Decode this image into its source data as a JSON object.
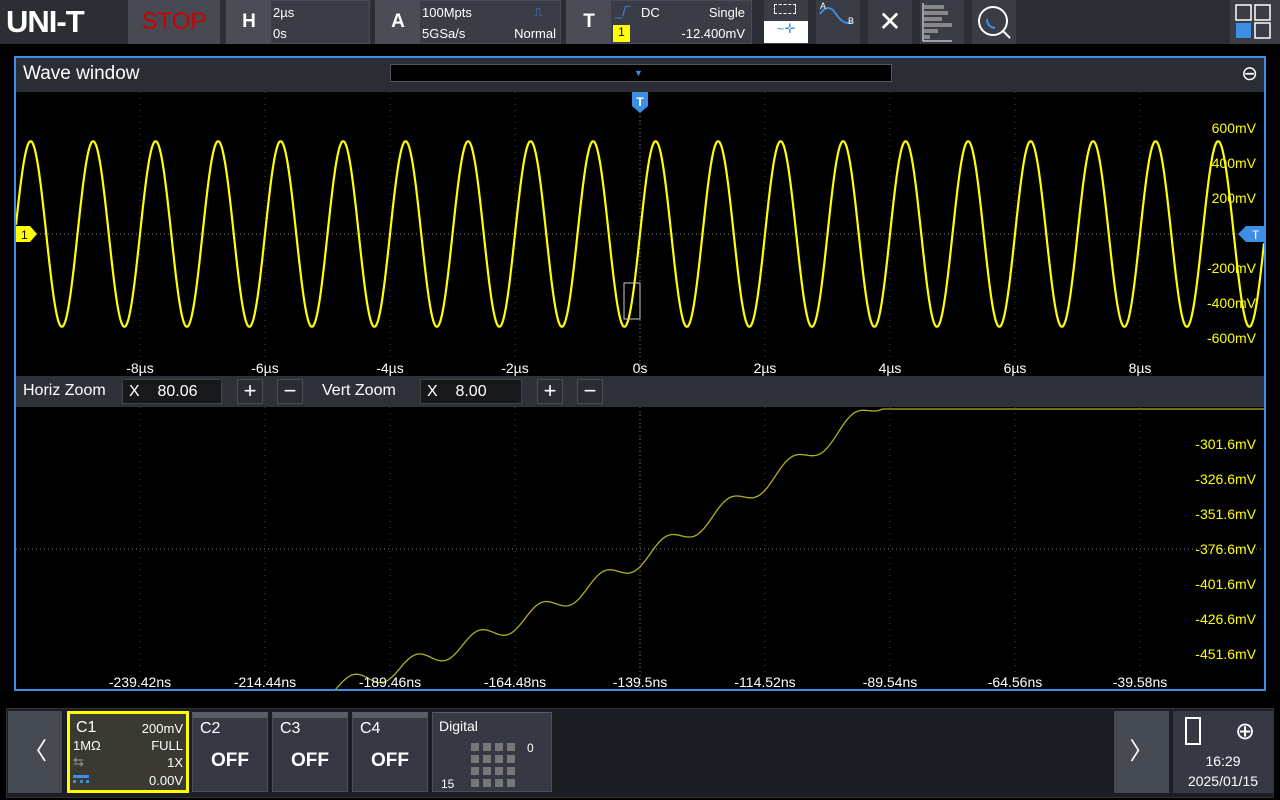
{
  "brand": "UNI-T",
  "run_state": "STOP",
  "horizontal": {
    "label": "H",
    "timebase": "2µs",
    "position": "0s"
  },
  "acquire": {
    "label": "A",
    "depth": "100Mpts",
    "rate": "5GSa/s",
    "mode": "Normal"
  },
  "trigger": {
    "label": "T",
    "coupling": "DC",
    "sweep": "Single",
    "source": "1",
    "level": "-12.400mV"
  },
  "toolbar_icons": [
    "touch-select-icon",
    "cursor-ab-icon",
    "measure-ruler-icon",
    "histogram-icon",
    "search-icon",
    "layout-grid-icon"
  ],
  "wave_window": {
    "title": "Wave window",
    "trigger_marker": "T",
    "channel_marker": "1",
    "main_volt_labels": [
      "600mV",
      "400mV",
      "200mV",
      "-200mV",
      "-400mV",
      "-600mV"
    ],
    "main_time_labels": [
      "-8µs",
      "-6µs",
      "-4µs",
      "-2µs",
      "0s",
      "2µs",
      "4µs",
      "6µs",
      "8µs"
    ],
    "zoom_volt_labels": [
      "-301.6mV",
      "-326.6mV",
      "-351.6mV",
      "-376.6mV",
      "-401.6mV",
      "-426.6mV",
      "-451.6mV"
    ],
    "zoom_time_labels": [
      "-239.42ns",
      "-214.44ns",
      "-189.46ns",
      "-164.48ns",
      "-139.5ns",
      "-114.52ns",
      "-89.54ns",
      "-64.56ns",
      "-39.58ns"
    ]
  },
  "signal": {
    "frequency_hz": 1000000,
    "amplitude_v": 0.5,
    "color": "#ffff00"
  },
  "zoom_bar": {
    "horiz_label": "Horiz Zoom",
    "horiz_x": "X",
    "horiz_value": "80.06",
    "vert_label": "Vert Zoom",
    "vert_x": "X",
    "vert_value": "8.00",
    "plus": "+",
    "minus": "−"
  },
  "channels": {
    "c1": {
      "name": "C1",
      "scale": "200mV",
      "impedance": "1MΩ",
      "bandwidth": "FULL",
      "probe": "1X",
      "offset": "0.00V"
    },
    "c2": {
      "name": "C2",
      "state": "OFF"
    },
    "c3": {
      "name": "C3",
      "state": "OFF"
    },
    "c4": {
      "name": "C4",
      "state": "OFF"
    },
    "digital": {
      "name": "Digital",
      "high": "0",
      "low": "15"
    }
  },
  "status": {
    "time": "16:29",
    "date": "2025/01/15"
  }
}
